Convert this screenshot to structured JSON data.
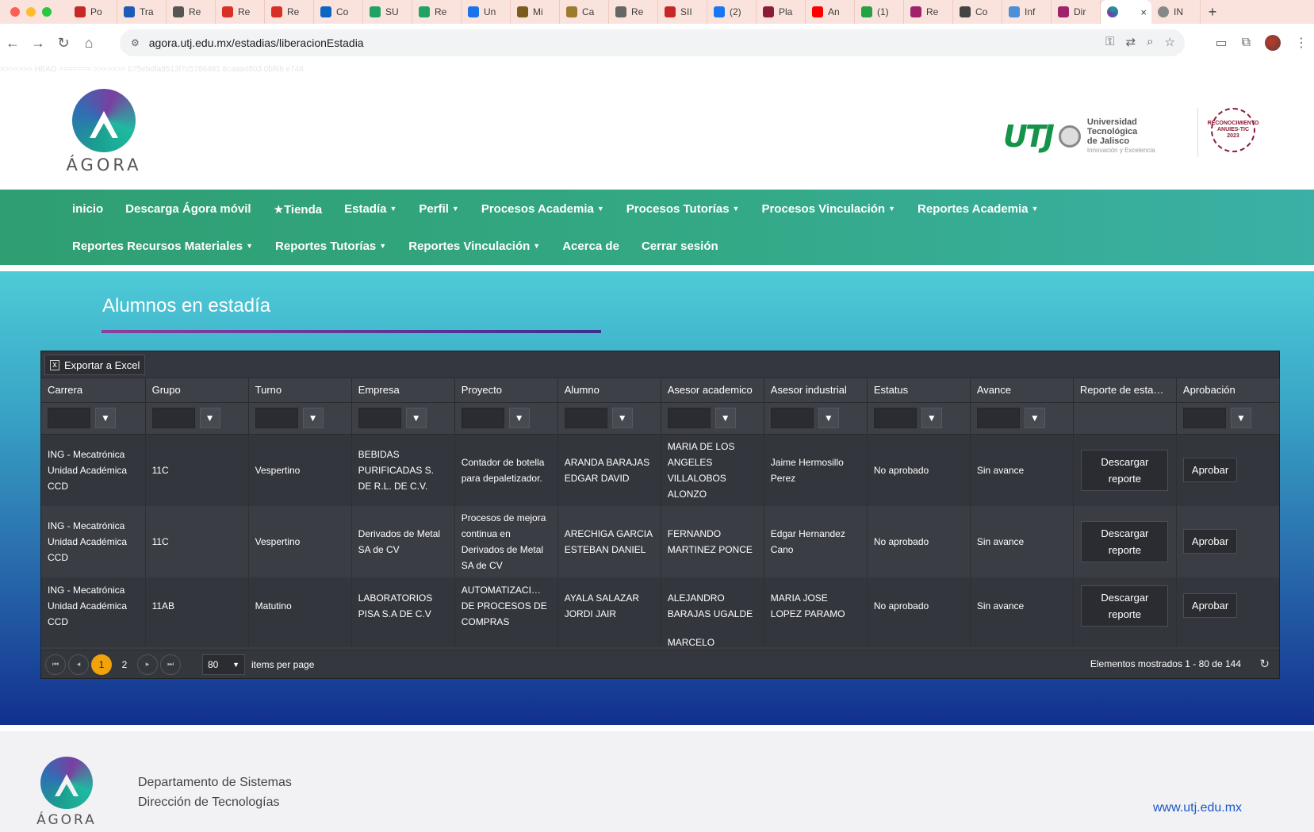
{
  "browser": {
    "tabs": [
      {
        "label": "Po",
        "color": "#c62828"
      },
      {
        "label": "Tra",
        "color": "#1e5bb8"
      },
      {
        "label": "Re",
        "color": "#555555"
      },
      {
        "label": "Re",
        "color": "#d93025"
      },
      {
        "label": "Re",
        "color": "#d93025"
      },
      {
        "label": "Co",
        "color": "#0a66c2"
      },
      {
        "label": "SU",
        "color": "#1ea362"
      },
      {
        "label": "Re",
        "color": "#1ea362"
      },
      {
        "label": "Un",
        "color": "#1a73e8"
      },
      {
        "label": "Mi",
        "color": "#7b5b1e"
      },
      {
        "label": "Ca",
        "color": "#9c7a2e"
      },
      {
        "label": "Re",
        "color": "#666666"
      },
      {
        "label": "SII",
        "color": "#c62828"
      },
      {
        "label": "(2)",
        "color": "#1877f2"
      },
      {
        "label": "Pla",
        "color": "#8b1b36"
      },
      {
        "label": "An",
        "color": "#ff0000"
      },
      {
        "label": "(1)",
        "color": "#25a244"
      },
      {
        "label": "Re",
        "color": "#a0226a"
      },
      {
        "label": "Co",
        "color": "#444444"
      },
      {
        "label": "Inf",
        "color": "#4a90d9"
      },
      {
        "label": "Dir",
        "color": "#a0226a"
      }
    ],
    "active_tab": {
      "label": "",
      "close": "×"
    },
    "last_tab": {
      "label": "IN",
      "color": "#888888"
    },
    "new_tab": "+",
    "url": "agora.utj.edu.mx/estadias/liberacionEstadia"
  },
  "header": {
    "debug_text": ">>>>>>> HEAD ======= >>>>>>> b75ebdfa9513f7c5786481 8caaa4803 0bf6b e748",
    "logo_word": "ÁGORA",
    "utj": {
      "mark": "UTJ",
      "line1": "Universidad Tecnológica",
      "line2": "de Jalisco",
      "tagline": "Innovación y Excelencia"
    },
    "anuies": {
      "line1": "RECONOCIMIENTO",
      "line2": "ANUIES-TIC",
      "line3": "2023"
    }
  },
  "nav": {
    "row1": [
      {
        "label": "inicio",
        "caret": false
      },
      {
        "label": "Descarga Ágora móvil",
        "caret": false
      },
      {
        "label": "★Tienda",
        "caret": false
      },
      {
        "label": "Estadía",
        "caret": true
      },
      {
        "label": "Perfil",
        "caret": true
      },
      {
        "label": "Procesos Academia",
        "caret": true
      },
      {
        "label": "Procesos Tutorías",
        "caret": true
      },
      {
        "label": "Procesos Vinculación",
        "caret": true
      },
      {
        "label": "Reportes Academia",
        "caret": true
      }
    ],
    "row2": [
      {
        "label": "Reportes Recursos Materiales",
        "caret": true
      },
      {
        "label": "Reportes Tutorías",
        "caret": true
      },
      {
        "label": "Reportes Vinculación",
        "caret": true
      },
      {
        "label": "Acerca de",
        "caret": false
      },
      {
        "label": "Cerrar sesión",
        "caret": false
      }
    ]
  },
  "main": {
    "title": "Alumnos en estadía",
    "export_label": "Exportar a Excel",
    "columns": [
      "Carrera",
      "Grupo",
      "Turno",
      "Empresa",
      "Proyecto",
      "Alumno",
      "Asesor academico",
      "Asesor industrial",
      "Estatus",
      "Avance",
      "Reporte de esta…",
      "Aprobación"
    ],
    "rows": [
      {
        "carrera": "ING - Mecatrónica Unidad Académica CCD",
        "grupo": "11C",
        "turno": "Vespertino",
        "empresa": "BEBIDAS PURIFICADAS S. DE R.L. DE C.V.",
        "proyecto": "Contador de botella para depaletizador.",
        "alumno": "ARANDA BARAJAS EDGAR DAVID",
        "asesor_academico": "MARIA DE LOS ANGELES VILLALOBOS ALONZO",
        "asesor_industrial": "Jaime Hermosillo Perez",
        "estatus": "No aprobado",
        "avance": "Sin avance",
        "reporte": "Descargar reporte",
        "aprobacion": "Aprobar"
      },
      {
        "carrera": "ING - Mecatrónica Unidad Académica CCD",
        "grupo": "11C",
        "turno": "Vespertino",
        "empresa": "Derivados de Metal SA de CV",
        "proyecto": "Procesos de mejora continua en Derivados de Metal SA de CV",
        "alumno": "ARECHIGA GARCIA ESTEBAN DANIEL",
        "asesor_academico": "FERNANDO MARTINEZ PONCE",
        "asesor_industrial": "Edgar Hernandez Cano",
        "estatus": "No aprobado",
        "avance": "Sin avance",
        "reporte": "Descargar reporte",
        "aprobacion": "Aprobar"
      },
      {
        "carrera": "ING - Mecatrónica Unidad Académica CCD",
        "grupo": "11AB",
        "turno": "Matutino",
        "empresa": "LABORATORIOS PISA S.A DE C.V",
        "proyecto": "AUTOMATIZACI… DE PROCESOS DE COMPRAS",
        "alumno": "AYALA SALAZAR JORDI JAIR",
        "asesor_academico": "ALEJANDRO BARAJAS UGALDE",
        "asesor_industrial": "MARIA JOSE LOPEZ PARAMO",
        "estatus": "No aprobado",
        "avance": "Sin avance",
        "reporte": "Descargar reporte",
        "aprobacion": "Aprobar"
      }
    ],
    "partial_row_asesor": "MARCELO",
    "pager": {
      "pages": [
        "1",
        "2"
      ],
      "current": "1",
      "page_size": "80",
      "items_per_page": "items per page",
      "info": "Elementos mostrados 1 - 80 de 144"
    }
  },
  "footer": {
    "logo_word": "ÁGORA",
    "line1": "Departamento de Sistemas",
    "line2": "Dirección de Tecnologías",
    "link": "www.utj.edu.mx"
  }
}
